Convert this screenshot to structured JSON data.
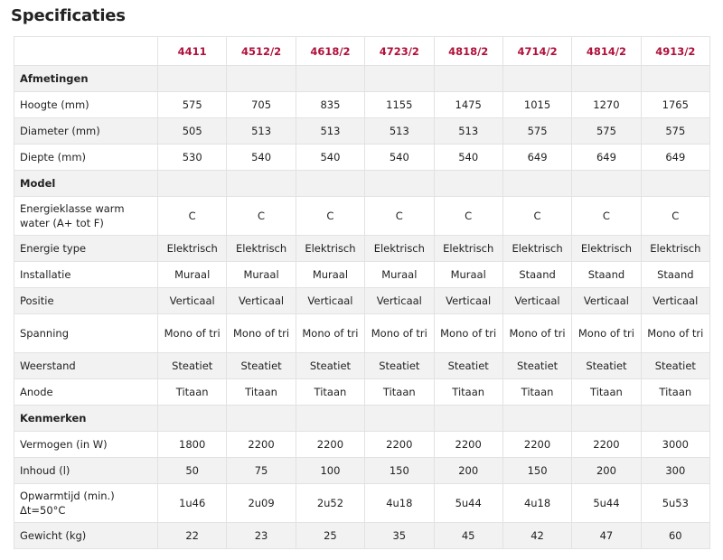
{
  "title": "Specificaties",
  "models": [
    "4411",
    "4512/2",
    "4618/2",
    "4723/2",
    "4818/2",
    "4714/2",
    "4814/2",
    "4913/2"
  ],
  "rows": [
    {
      "type": "section",
      "label": "Afmetingen"
    },
    {
      "type": "data",
      "label": "Hoogte (mm)",
      "values": [
        "575",
        "705",
        "835",
        "1155",
        "1475",
        "1015",
        "1270",
        "1765"
      ]
    },
    {
      "type": "data",
      "label": "Diameter (mm)",
      "values": [
        "505",
        "513",
        "513",
        "513",
        "513",
        "575",
        "575",
        "575"
      ]
    },
    {
      "type": "data",
      "label": "Diepte (mm)",
      "values": [
        "530",
        "540",
        "540",
        "540",
        "540",
        "649",
        "649",
        "649"
      ]
    },
    {
      "type": "section",
      "label": "Model"
    },
    {
      "type": "data",
      "label": "Energieklasse warm water (A+ tot F)",
      "values": [
        "C",
        "C",
        "C",
        "C",
        "C",
        "C",
        "C",
        "C"
      ],
      "tall": true
    },
    {
      "type": "data",
      "label": "Energie type",
      "values": [
        "Elektrisch",
        "Elektrisch",
        "Elektrisch",
        "Elektrisch",
        "Elektrisch",
        "Elektrisch",
        "Elektrisch",
        "Elektrisch"
      ]
    },
    {
      "type": "data",
      "label": "Installatie",
      "values": [
        "Muraal",
        "Muraal",
        "Muraal",
        "Muraal",
        "Muraal",
        "Staand",
        "Staand",
        "Staand"
      ]
    },
    {
      "type": "data",
      "label": "Positie",
      "values": [
        "Verticaal",
        "Verticaal",
        "Verticaal",
        "Verticaal",
        "Verticaal",
        "Verticaal",
        "Verticaal",
        "Verticaal"
      ]
    },
    {
      "type": "data",
      "label": "Spanning",
      "values": [
        "Mono of tri",
        "Mono of tri",
        "Mono of tri",
        "Mono of tri",
        "Mono of tri",
        "Mono of tri",
        "Mono of tri",
        "Mono of tri"
      ],
      "tall": true
    },
    {
      "type": "data",
      "label": "Weerstand",
      "values": [
        "Steatiet",
        "Steatiet",
        "Steatiet",
        "Steatiet",
        "Steatiet",
        "Steatiet",
        "Steatiet",
        "Steatiet"
      ]
    },
    {
      "type": "data",
      "label": "Anode",
      "values": [
        "Titaan",
        "Titaan",
        "Titaan",
        "Titaan",
        "Titaan",
        "Titaan",
        "Titaan",
        "Titaan"
      ]
    },
    {
      "type": "section",
      "label": "Kenmerken"
    },
    {
      "type": "data",
      "label": "Vermogen (in W)",
      "values": [
        "1800",
        "2200",
        "2200",
        "2200",
        "2200",
        "2200",
        "2200",
        "3000"
      ]
    },
    {
      "type": "data",
      "label": "Inhoud (l)",
      "values": [
        "50",
        "75",
        "100",
        "150",
        "200",
        "150",
        "200",
        "300"
      ]
    },
    {
      "type": "data",
      "label": "Opwarmtijd (min.) Δt=50°C",
      "values": [
        "1u46",
        "2u09",
        "2u52",
        "4u18",
        "5u44",
        "4u18",
        "5u44",
        "5u53"
      ],
      "tall": true
    },
    {
      "type": "data",
      "label": "Gewicht (kg)",
      "values": [
        "22",
        "23",
        "25",
        "35",
        "45",
        "42",
        "47",
        "60"
      ]
    }
  ]
}
